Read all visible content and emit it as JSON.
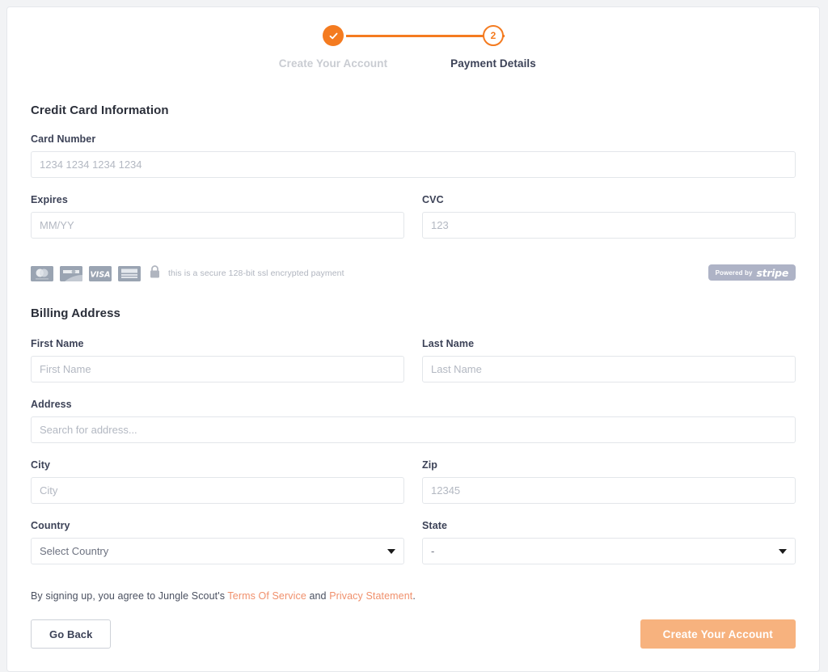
{
  "stepper": {
    "steps": [
      {
        "label": "Create Your Account",
        "marker": "✓",
        "state": "done"
      },
      {
        "label": "Payment Details",
        "marker": "2",
        "state": "current"
      }
    ]
  },
  "credit_card": {
    "section_title": "Credit Card Information",
    "card_number": {
      "label": "Card Number",
      "value": "",
      "placeholder": "1234 1234 1234 1234"
    },
    "expires": {
      "label": "Expires",
      "value": "",
      "placeholder": "MM/YY"
    },
    "cvc": {
      "label": "CVC",
      "value": "",
      "placeholder": "123"
    }
  },
  "secure_row": {
    "cards": [
      "mastercard",
      "discover",
      "visa",
      "amex"
    ],
    "card_labels": {
      "mastercard": "mastercard",
      "discover": "DISCOVER",
      "visa": "VISA",
      "amex": "AMERICAN EXPRESS"
    },
    "lock_icon": "lock-icon",
    "text": "this is a secure 128-bit ssl encrypted payment",
    "stripe": {
      "powered_by": "Powered by",
      "brand": "stripe"
    }
  },
  "billing": {
    "section_title": "Billing Address",
    "first_name": {
      "label": "First Name",
      "value": "",
      "placeholder": "First Name"
    },
    "last_name": {
      "label": "Last Name",
      "value": "",
      "placeholder": "Last Name"
    },
    "address": {
      "label": "Address",
      "value": "",
      "placeholder": "Search for address..."
    },
    "city": {
      "label": "City",
      "value": "",
      "placeholder": "City"
    },
    "zip": {
      "label": "Zip",
      "value": "",
      "placeholder": "12345"
    },
    "country": {
      "label": "Country",
      "selected": "Select Country"
    },
    "state": {
      "label": "State",
      "selected": "-"
    }
  },
  "terms": {
    "prefix": "By signing up, you agree to Jungle Scout's ",
    "terms_link": "Terms Of Service",
    "middle": " and ",
    "privacy_link": "Privacy Statement",
    "suffix": "."
  },
  "footer": {
    "back_label": "Go Back",
    "submit_label": "Create Your Account"
  },
  "colors": {
    "accent": "#f47b20",
    "accent_muted": "#f7b27e",
    "link": "#f0906c",
    "page_bg": "#f2f3f5",
    "card_bg": "#ffffff",
    "border": "#e3e6ea",
    "text": "#3c4257",
    "placeholder": "#b3b8c2",
    "muted": "#c9ccd2",
    "stripe_badge": "#aeb3c6",
    "card_logo": "#9aa4b2"
  }
}
